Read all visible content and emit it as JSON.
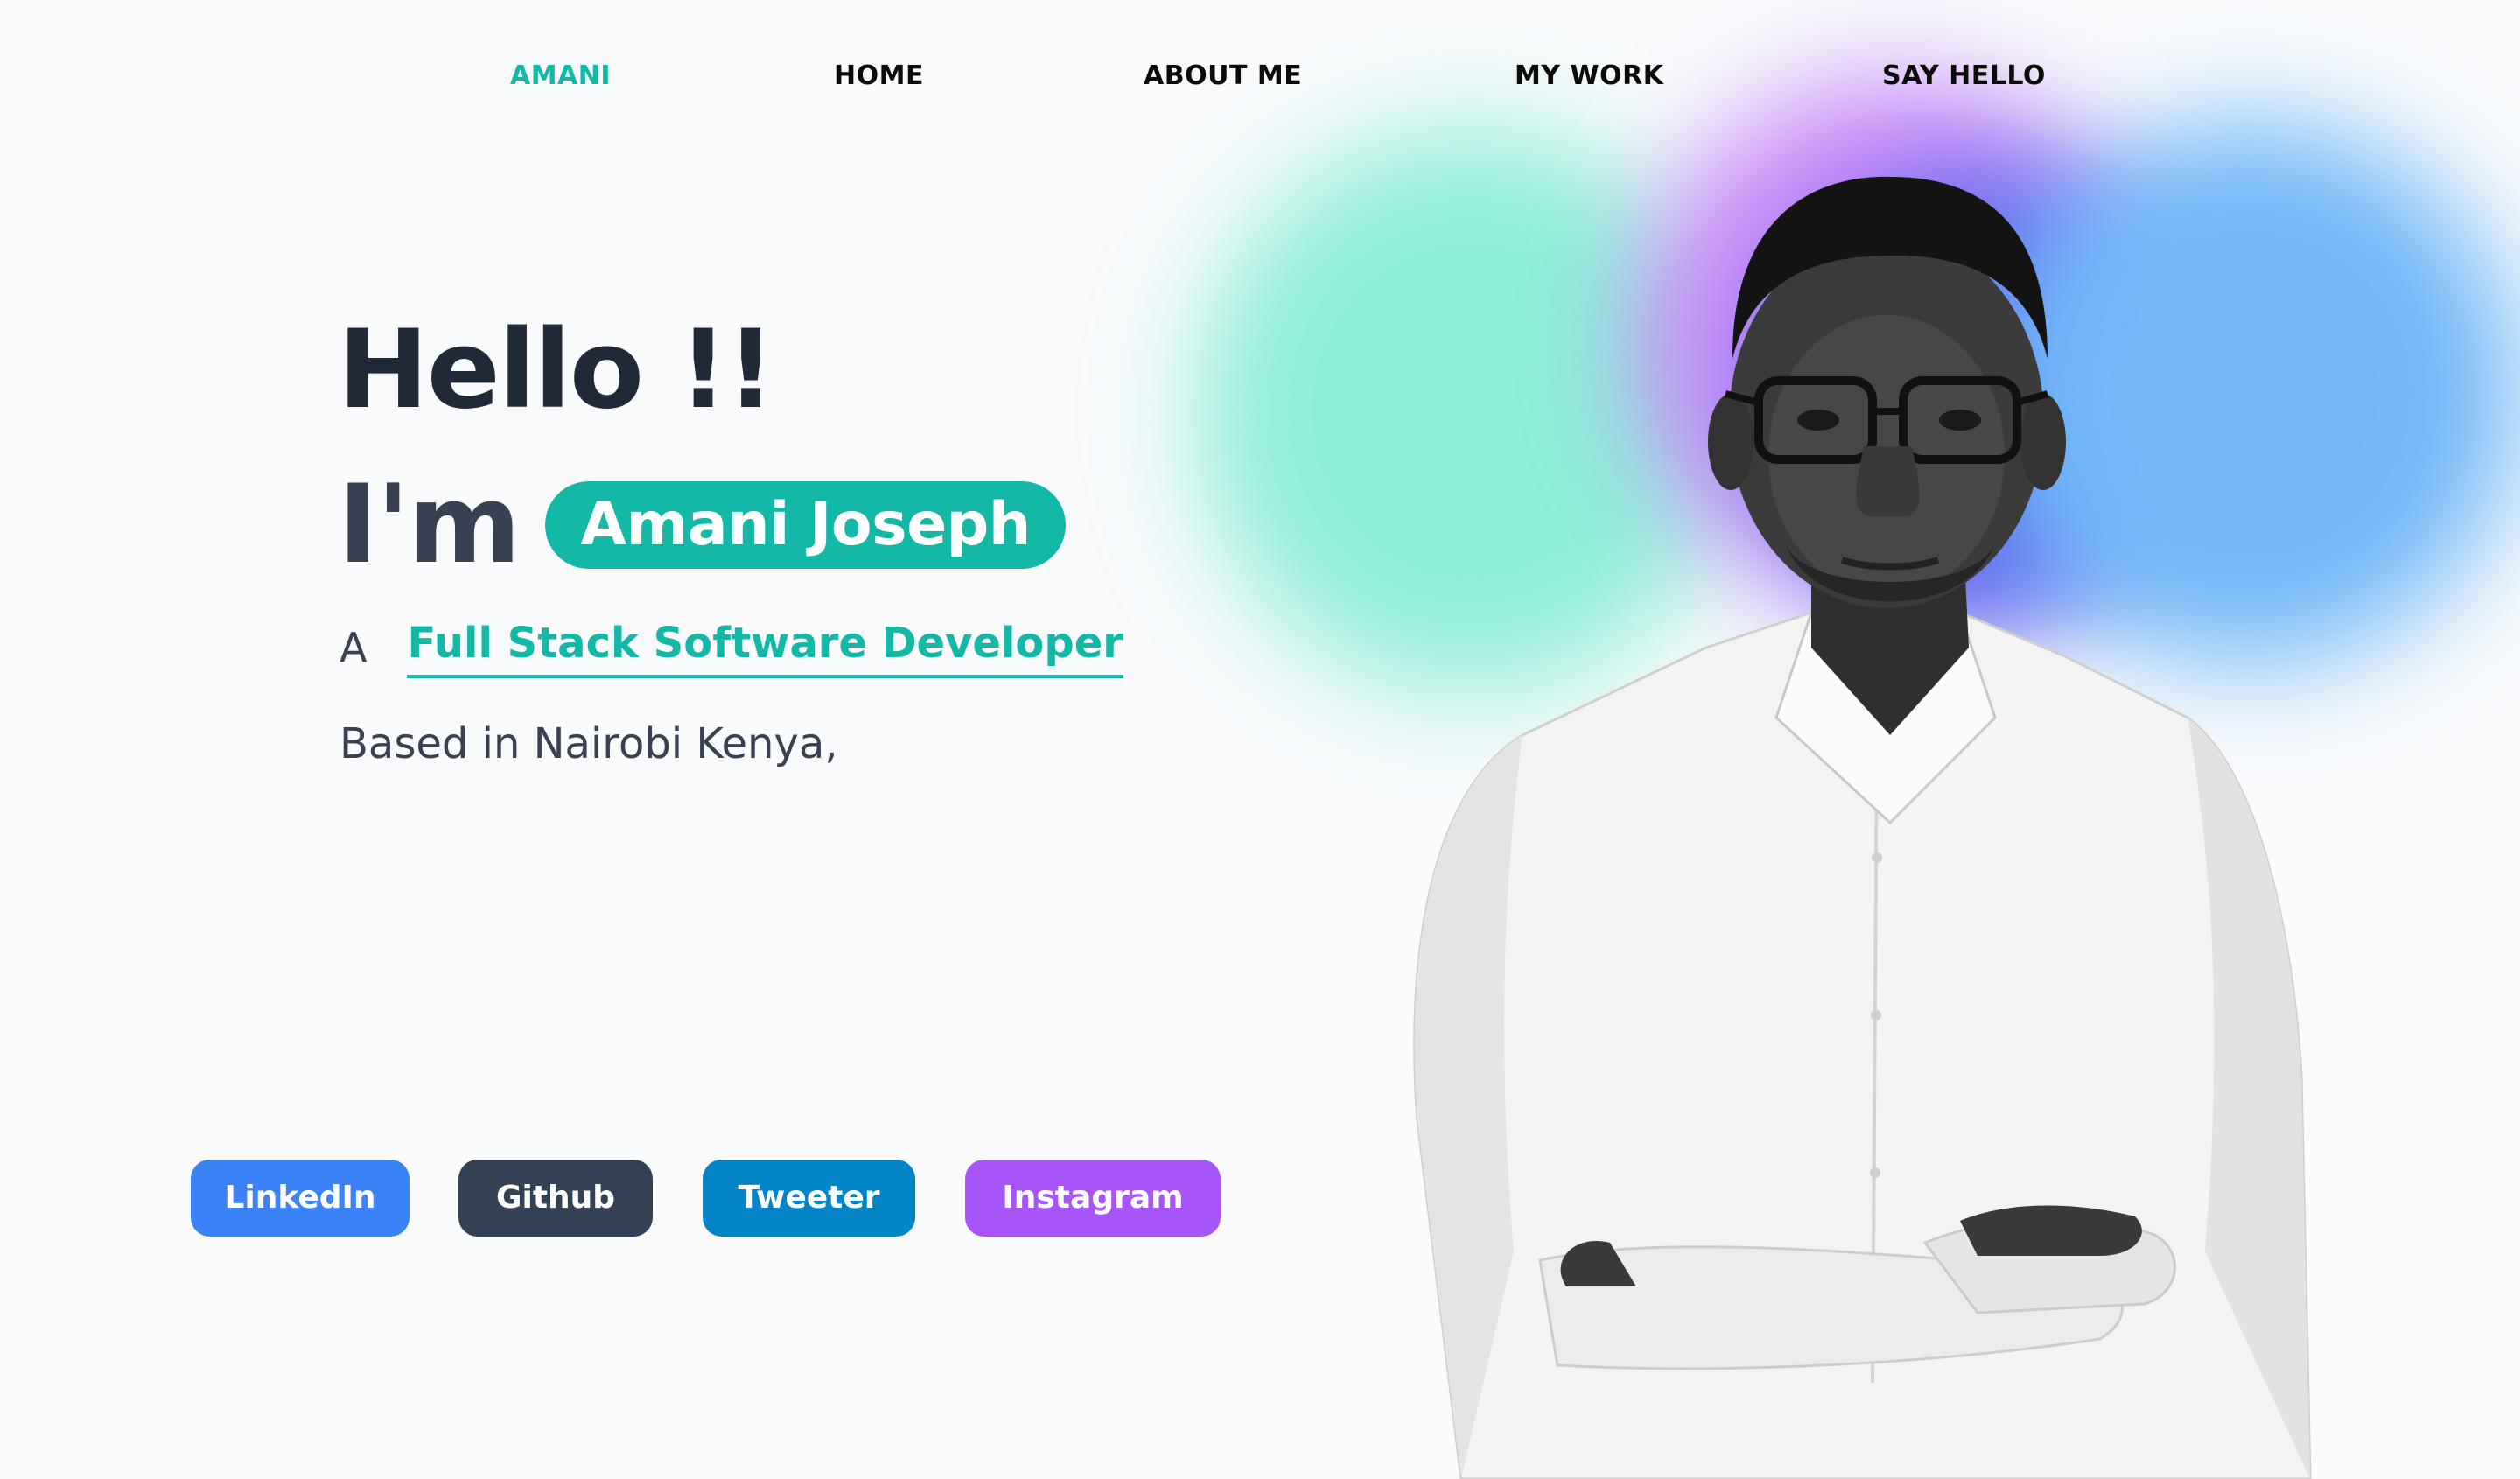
{
  "nav": {
    "brand": "AMANI",
    "items": [
      {
        "label": "HOME"
      },
      {
        "label": "ABOUT ME"
      },
      {
        "label": "MY WORK"
      },
      {
        "label": "SAY HELLO"
      }
    ]
  },
  "hero": {
    "greeting": "Hello !!",
    "intro": "I'm",
    "name": "Amani Joseph",
    "role_prefix": "A",
    "role": "Full Stack Software Developer",
    "location": "Based in Nairobi Kenya,"
  },
  "social": {
    "linkedin": "LinkedIn",
    "github": "Github",
    "tweeter": "Tweeter",
    "instagram": "Instagram"
  },
  "colors": {
    "accent": "#14b8a6",
    "text_dark": "#1f2937",
    "linkedin": "#3b82f6",
    "github": "#334155",
    "tweeter": "#0284c7",
    "instagram": "#a855f7"
  },
  "portrait": {
    "icon": "person-photo"
  }
}
